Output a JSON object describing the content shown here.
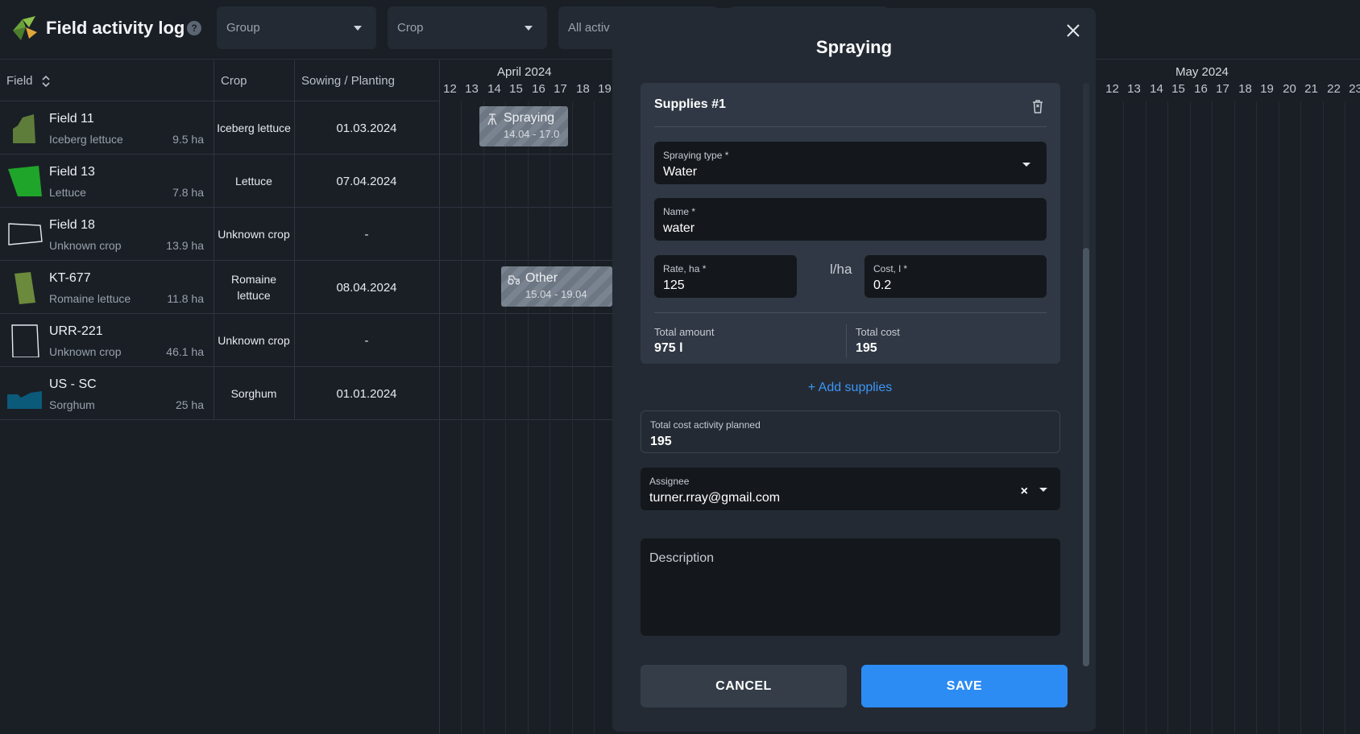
{
  "header": {
    "title": "Field activity log",
    "help": "?",
    "filters": {
      "group_placeholder": "Group",
      "crop_placeholder": "Crop",
      "activity_placeholder": "All activ"
    }
  },
  "table": {
    "columns": {
      "field": "Field",
      "crop": "Crop",
      "sowing": "Sowing / Planting"
    },
    "rows": [
      {
        "name": "Field 11",
        "crop": "Iceberg lettuce",
        "area": "9.5 ha",
        "crop_col": "Iceberg lettuce",
        "date": "01.03.2024",
        "color": "#5f7d3a"
      },
      {
        "name": "Field 13",
        "crop": "Lettuce",
        "area": "7.8 ha",
        "crop_col": "Lettuce",
        "date": "07.04.2024",
        "color": "#1fa52a"
      },
      {
        "name": "Field 18",
        "crop": "Unknown crop",
        "area": "13.9 ha",
        "crop_col": "Unknown crop",
        "date": "-",
        "color": "#ffffff"
      },
      {
        "name": "KT-677",
        "crop": "Romaine lettuce",
        "area": "11.8 ha",
        "crop_col": "Romaine lettuce",
        "date": "08.04.2024",
        "color": "#6b8a3c"
      },
      {
        "name": "URR-221",
        "crop": "Unknown crop",
        "area": "46.1 ha",
        "crop_col": "Unknown crop",
        "date": "-",
        "color": "#ffffff"
      },
      {
        "name": "US - SC",
        "crop": "Sorghum",
        "area": "25 ha",
        "crop_col": "Sorghum",
        "date": "01.01.2024",
        "color": "#0b5a7a"
      }
    ]
  },
  "timeline": {
    "april_label": "April 2024",
    "may_label": "May 2024",
    "april_days": [
      "12",
      "13",
      "14",
      "15",
      "16",
      "17",
      "18",
      "19"
    ],
    "may_days": [
      "12",
      "13",
      "14",
      "15",
      "16",
      "17",
      "18",
      "19",
      "20",
      "21",
      "22",
      "23"
    ],
    "events": [
      {
        "title": "Spraying",
        "dates": "14.04 - 17.0"
      },
      {
        "title": "Other",
        "dates": "15.04 - 19.04"
      }
    ]
  },
  "modal": {
    "title": "Spraying",
    "supplies": {
      "title": "Supplies #1",
      "spraying_type_label": "Spraying type *",
      "spraying_type_value": "Water",
      "name_label": "Name *",
      "name_value": "water",
      "rate_label": "Rate, ha  *",
      "rate_value": "125",
      "unit": "l/ha",
      "cost_label": "Cost, l  *",
      "cost_value": "0.2",
      "total_amount_label": "Total amount",
      "total_amount_value": "975 l",
      "total_cost_label": "Total cost",
      "total_cost_value": "195"
    },
    "add_supplies": "+ Add supplies",
    "total_cost_planned_label": "Total cost activity planned",
    "total_cost_planned_value": "195",
    "assignee_label": "Assignee",
    "assignee_value": "turner.rray@gmail.com",
    "clear": "×",
    "description_placeholder": "Description",
    "cancel": "CANCEL",
    "save": "SAVE"
  }
}
